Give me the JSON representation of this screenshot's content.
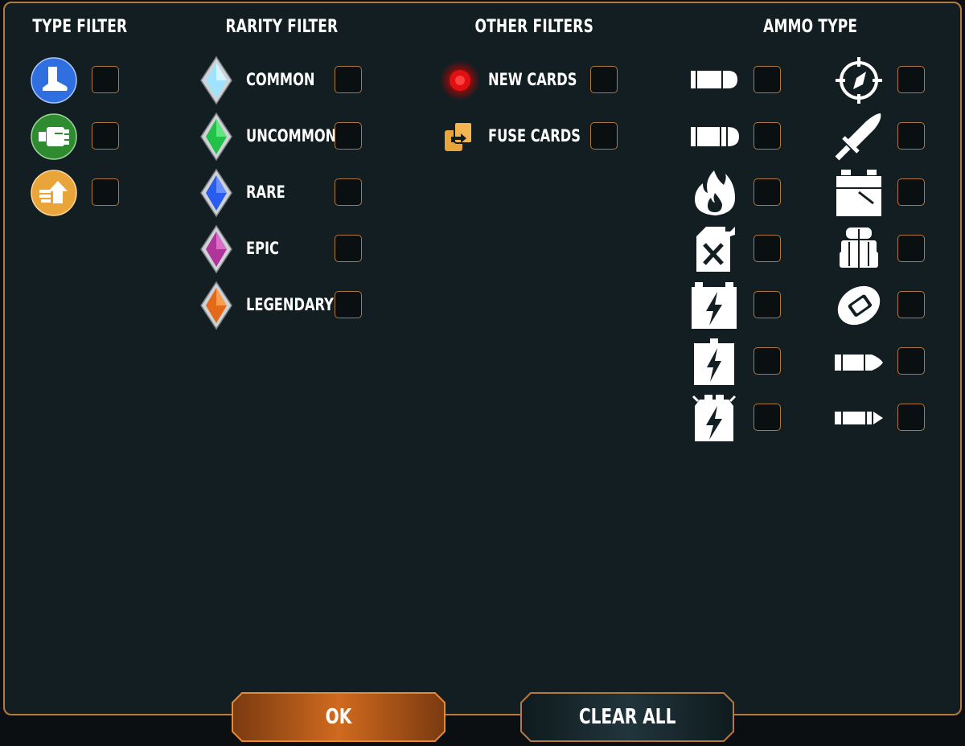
{
  "headings": {
    "type": "TYPE FILTER",
    "rarity": "RARITY FILTER",
    "other": "OTHER FILTERS",
    "ammo": "AMMO TYPE"
  },
  "rarity": {
    "common": "COMMON",
    "uncommon": "UNCOMMON",
    "rare": "RARE",
    "epic": "EPIC",
    "legendary": "LEGENDARY"
  },
  "other": {
    "new_cards": "NEW CARDS",
    "fuse_cards": "FUSE CARDS"
  },
  "buttons": {
    "ok": "OK",
    "clear_all": "CLEAR ALL"
  },
  "colors": {
    "accent": "#b77a3d",
    "panel": "#121e21",
    "type_blue": "#2f6fe0",
    "type_green": "#2e8b2f",
    "type_orange": "#e9a43a",
    "common": "#9fe3ff",
    "uncommon": "#22c24a",
    "rare": "#2b5cf0",
    "epic": "#b0349a",
    "legendary": "#e46a1a",
    "new_dot": "#e01010",
    "ok_button": "#c9661d",
    "clear_button": "#1a2a30"
  },
  "icons": {
    "type": [
      "boot-icon",
      "fist-icon",
      "arrow-hand-icon"
    ],
    "ammo_left": [
      "bullet-icon",
      "shell-icon",
      "fire-icon",
      "fuel-can-icon",
      "battery-large-icon",
      "battery-small-icon",
      "battery-sparks-icon"
    ],
    "ammo_right": [
      "crosshair-icon",
      "blade-icon",
      "power-cell-icon",
      "canister-icon",
      "grenade-icon",
      "rifle-round-icon",
      "bolt-round-icon"
    ]
  },
  "filters": {
    "type_checked": [
      false,
      false,
      false
    ],
    "rarity_checked": [
      false,
      false,
      false,
      false,
      false
    ],
    "other_checked": [
      false,
      false
    ],
    "ammo_left_checked": [
      false,
      false,
      false,
      false,
      false,
      false,
      false
    ],
    "ammo_right_checked": [
      false,
      false,
      false,
      false,
      false,
      false,
      false
    ]
  }
}
